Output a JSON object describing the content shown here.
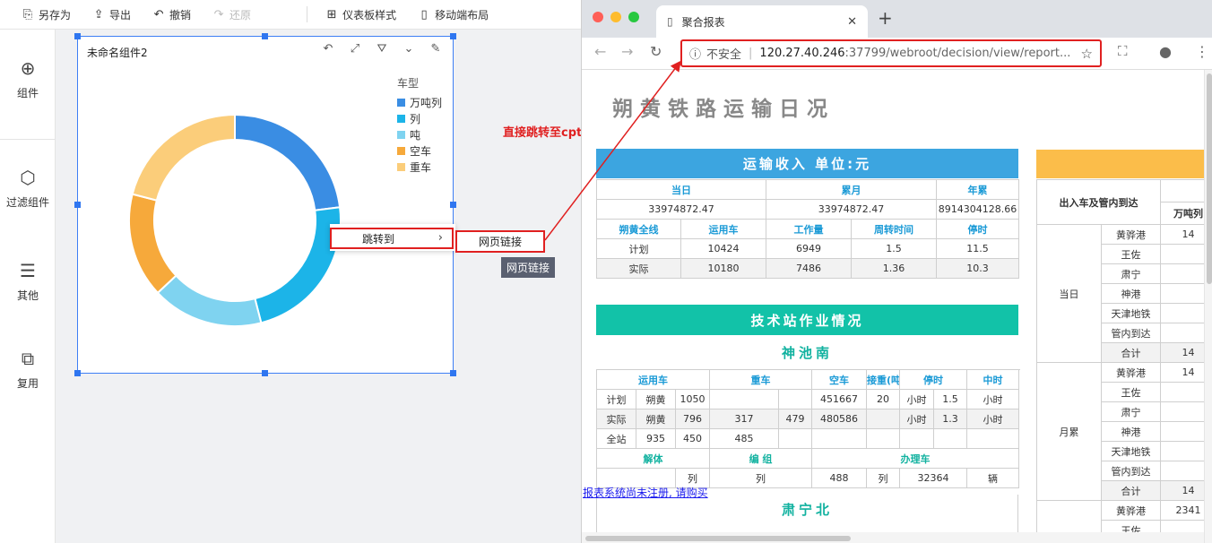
{
  "toolbar": {
    "items": [
      {
        "label": "另存为",
        "icon": "save-as-icon"
      },
      {
        "label": "导出",
        "icon": "export-icon"
      },
      {
        "label": "撤销",
        "icon": "undo-icon"
      },
      {
        "label": "还原",
        "icon": "redo-icon",
        "disabled": true
      },
      {
        "label": "仪表板样式",
        "icon": "dashboard-style-icon"
      },
      {
        "label": "移动端布局",
        "icon": "mobile-layout-icon"
      }
    ]
  },
  "sidebar": {
    "items": [
      {
        "label": "组件",
        "icon": "plus-circle-icon"
      },
      {
        "label": "过滤组件",
        "icon": "cube-icon"
      },
      {
        "label": "其他",
        "icon": "document-icon"
      },
      {
        "label": "复用",
        "icon": "copy-layers-icon"
      }
    ]
  },
  "widget": {
    "title": "未命名组件2",
    "tools": [
      "undo-icon",
      "expand-icon",
      "filter-icon",
      "dropdown-icon",
      "edit-icon"
    ]
  },
  "chart_data": {
    "type": "pie",
    "donut": true,
    "title": "",
    "legend_title": "车型",
    "legend_position": "top-right",
    "categories": [
      "万吨列",
      "列",
      "吨",
      "空车",
      "重车"
    ],
    "values": [
      23,
      23,
      17,
      16,
      21
    ],
    "colors": [
      "#3a8de3",
      "#1cb4e8",
      "#7fd3f0",
      "#f6a93b",
      "#fbcd7a"
    ]
  },
  "context_menu": {
    "item_label": "跳转到",
    "submenu_label": "网页链接",
    "tooltip": "网页链接"
  },
  "annotation": {
    "text": "直接跳转至cpt模板",
    "color": "#e02020"
  },
  "unregistered_link": "报表系统尚未注册, 请购买",
  "browser": {
    "tab_title": "聚合报表",
    "security_label": "不安全",
    "host": "120.27.40.246",
    "path": ":37799/webroot/decision/view/report..."
  },
  "report": {
    "title": "朔黄铁路运输日况",
    "income": {
      "header": "运输收入 单位:元",
      "col_heads": [
        "当日",
        "累月",
        "年累"
      ],
      "values": [
        "33974872.47",
        "33974872.47",
        "8914304128.66"
      ],
      "sub_heads": [
        "朔黄全线",
        "运用车",
        "工作量",
        "周转时间",
        "停时"
      ],
      "rows": [
        [
          "计划",
          "10424",
          "6949",
          "1.5",
          "11.5"
        ],
        [
          "实际",
          "10180",
          "7486",
          "1.36",
          "10.3"
        ]
      ]
    },
    "station": {
      "header": "技术站作业情况",
      "name1": "神池南",
      "col_heads": [
        "运用车",
        "重车",
        "空车",
        "接重(吨)",
        "停时",
        "中时"
      ],
      "rows": [
        [
          "计划",
          "朔黄",
          "1050",
          "",
          "",
          "451667",
          "20",
          "小时",
          "1.5",
          "小时"
        ],
        [
          "实际",
          "朔黄",
          "796",
          "317",
          "479",
          "480586",
          "",
          "小时",
          "1.3",
          "小时"
        ],
        [
          "全站",
          "935",
          "450",
          "485",
          "",
          "",
          "",
          "",
          "",
          ""
        ]
      ],
      "sub_heads": [
        "解体",
        "编 组",
        "办理车"
      ],
      "last_row": [
        "列",
        "列",
        "488",
        "列",
        "32364",
        "辆"
      ],
      "name2": "肃宁北"
    },
    "right": {
      "label": "出入车及管内到达",
      "col_head": "万吨列",
      "groups": [
        {
          "name": "当日",
          "rows": [
            [
              "黄骅港",
              "14"
            ],
            [
              "王佐",
              ""
            ],
            [
              "肃宁",
              ""
            ],
            [
              "神港",
              ""
            ],
            [
              "天津地铁",
              ""
            ],
            [
              "管内到达",
              ""
            ],
            [
              "合计",
              "14"
            ]
          ]
        },
        {
          "name": "月累",
          "rows": [
            [
              "黄骅港",
              "14"
            ],
            [
              "王佐",
              ""
            ],
            [
              "肃宁",
              ""
            ],
            [
              "神港",
              ""
            ],
            [
              "天津地铁",
              ""
            ],
            [
              "管内到达",
              ""
            ],
            [
              "合计",
              "14"
            ]
          ]
        },
        {
          "name": "",
          "rows": [
            [
              "黄骅港",
              "2341"
            ],
            [
              "王佐",
              ""
            ]
          ]
        }
      ]
    }
  }
}
